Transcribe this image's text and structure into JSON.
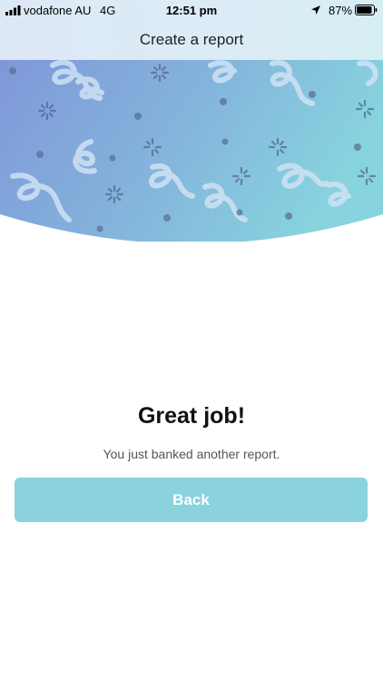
{
  "status_bar": {
    "carrier": "vodafone AU",
    "network": "4G",
    "time": "12:51 pm",
    "battery_percent": "87%",
    "icons": [
      "signal-bars-icon",
      "location-arrow-icon",
      "battery-icon"
    ]
  },
  "header": {
    "title": "Create a report"
  },
  "banner": {
    "decoration": "confetti-streamers",
    "gradient_colors": [
      "#7f98d8",
      "#86cfe0"
    ]
  },
  "main": {
    "headline": "Great job!",
    "message": "You just banked another report.",
    "back_label": "Back"
  },
  "colors": {
    "button": "#8ad2dd",
    "button_text": "#ffffff"
  }
}
